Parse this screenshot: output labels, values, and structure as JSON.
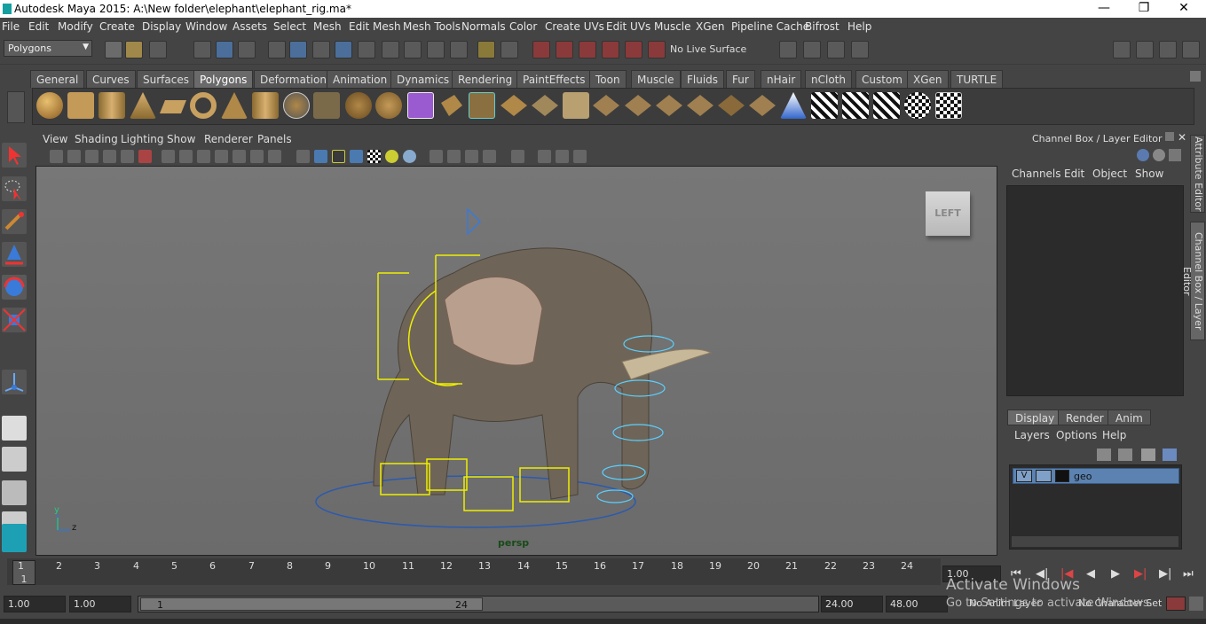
{
  "window": {
    "title": "Autodesk Maya 2015: A:\\New folder\\elephant\\elephant_rig.ma*"
  },
  "menu": [
    "File",
    "Edit",
    "Modify",
    "Create",
    "Display",
    "Window",
    "Assets",
    "Select",
    "Mesh",
    "Edit Mesh",
    "Mesh Tools",
    "Normals",
    "Color",
    "Create UVs",
    "Edit UVs",
    "Muscle",
    "XGen",
    "Pipeline Cache",
    "Bifrost",
    "Help"
  ],
  "status": {
    "menu_set": "Polygons",
    "live_surface": "No Live Surface"
  },
  "shelf_tabs": [
    "General",
    "Curves",
    "Surfaces",
    "Polygons",
    "Deformation",
    "Animation",
    "Dynamics",
    "Rendering",
    "PaintEffects",
    "Toon",
    "Muscle",
    "Fluids",
    "Fur",
    "nHair",
    "nCloth",
    "Custom",
    "XGen",
    "TURTLE"
  ],
  "shelf_active": "Polygons",
  "panel_menu": [
    "View",
    "Shading",
    "Lighting",
    "Show",
    "Renderer",
    "Panels"
  ],
  "viewport": {
    "camera": "persp",
    "cube_label": "LEFT",
    "axis_y": "y",
    "axis_z": "z"
  },
  "channel_box": {
    "title": "Channel Box / Layer Editor",
    "menu": [
      "Channels",
      "Edit",
      "Object",
      "Show"
    ]
  },
  "layer_editor": {
    "tabs": [
      "Display",
      "Render",
      "Anim"
    ],
    "active_tab": "Display",
    "menu": [
      "Layers",
      "Options",
      "Help"
    ],
    "layer": {
      "visible": "V",
      "name": "geo"
    }
  },
  "side_tabs": [
    "Attribute Editor",
    "Channel Box / Layer Editor"
  ],
  "time_slider": {
    "ticks": [
      "1",
      "2",
      "3",
      "4",
      "5",
      "6",
      "7",
      "8",
      "9",
      "10",
      "11",
      "12",
      "13",
      "14",
      "15",
      "16",
      "17",
      "18",
      "19",
      "20",
      "21",
      "22",
      "23",
      "24"
    ],
    "current_frame": "1",
    "time_field": "1.00"
  },
  "range": {
    "start": "1.00",
    "start_inner": "1.00",
    "handle_start": "1",
    "handle_end": "24",
    "end_inner": "24.00",
    "end": "48.00",
    "anim_layer": "No Anim Layer",
    "char_set": "No Character Set"
  },
  "watermark": {
    "line1": "Activate Windows",
    "line2": "Go to Settings to activate Windows."
  }
}
